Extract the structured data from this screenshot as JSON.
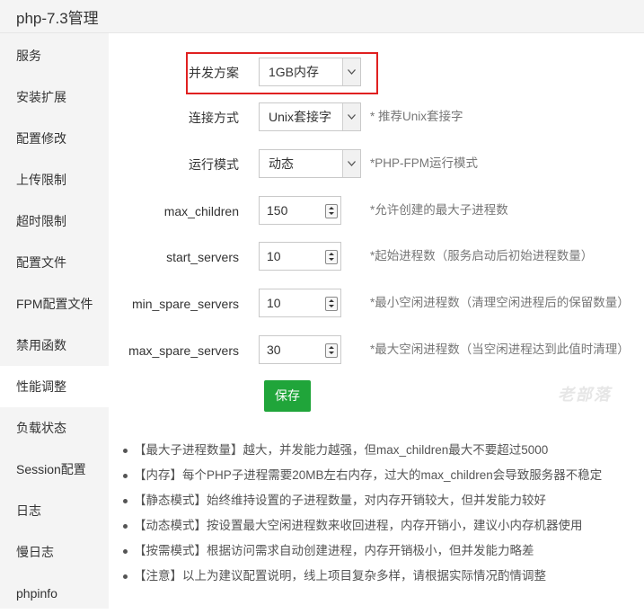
{
  "window": {
    "title": "php-7.3管理"
  },
  "sidebar": {
    "items": [
      {
        "label": "服务"
      },
      {
        "label": "安装扩展"
      },
      {
        "label": "配置修改"
      },
      {
        "label": "上传限制"
      },
      {
        "label": "超时限制"
      },
      {
        "label": "配置文件"
      },
      {
        "label": "FPM配置文件"
      },
      {
        "label": "禁用函数"
      },
      {
        "label": "性能调整",
        "active": true
      },
      {
        "label": "负载状态"
      },
      {
        "label": "Session配置"
      },
      {
        "label": "日志"
      },
      {
        "label": "慢日志"
      },
      {
        "label": "phpinfo"
      }
    ]
  },
  "form": {
    "concurrency": {
      "label": "并发方案",
      "value": "1GB内存"
    },
    "connection": {
      "label": "连接方式",
      "value": "Unix套接字",
      "hint": "* 推荐Unix套接字"
    },
    "run_mode": {
      "label": "运行模式",
      "value": "动态",
      "hint": "*PHP-FPM运行模式"
    },
    "max_children": {
      "label": "max_children",
      "value": "150",
      "hint": "*允许创建的最大子进程数"
    },
    "start_servers": {
      "label": "start_servers",
      "value": "10",
      "hint": "*起始进程数（服务启动后初始进程数量）"
    },
    "min_spare_servers": {
      "label": "min_spare_servers",
      "value": "10",
      "hint": "*最小空闲进程数（清理空闲进程后的保留数量）"
    },
    "max_spare_servers": {
      "label": "max_spare_servers",
      "value": "30",
      "hint": "*最大空闲进程数（当空闲进程达到此值时清理）"
    },
    "save_label": "保存"
  },
  "watermark": "老部落",
  "notes": [
    "【最大子进程数量】越大，并发能力越强，但max_children最大不要超过5000",
    "【内存】每个PHP子进程需要20MB左右内存，过大的max_children会导致服务器不稳定",
    "【静态模式】始终维持设置的子进程数量，对内存开销较大，但并发能力较好",
    "【动态模式】按设置最大空闲进程数来收回进程，内存开销小，建议小内存机器使用",
    "【按需模式】根据访问需求自动创建进程，内存开销极小，但并发能力略差",
    "【注意】以上为建议配置说明，线上项目复杂多样，请根据实际情况酌情调整"
  ],
  "colors": {
    "accent": "#20a53a",
    "highlight": "#e02020",
    "sidebar_bg": "#f4f4f4"
  }
}
